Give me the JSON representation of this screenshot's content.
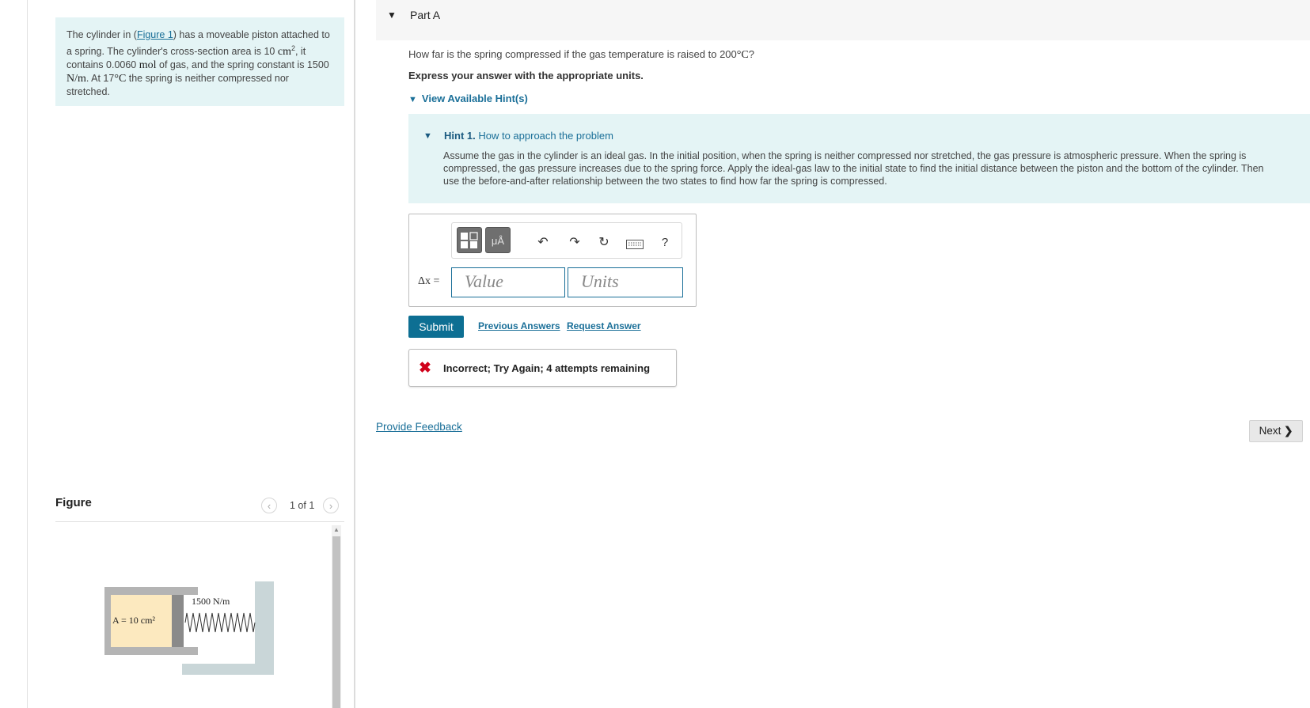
{
  "problem": {
    "text_1": "The cylinder in (",
    "figure_link": "Figure 1",
    "text_2": ") has a moveable piston attached to a spring. The cylinder's cross-section area is 10 ",
    "area_unit": "cm",
    "area_exp": "2",
    "text_3": ", it contains 0.0060 ",
    "mol_unit": "mol",
    "text_4": " of gas, and the spring constant is 1500 ",
    "k_unit": "N/m",
    "text_5": ". At 17",
    "temp_unit": "°C",
    "text_6": " the spring is neither compressed nor stretched."
  },
  "figure": {
    "title": "Figure",
    "pagination": "1 of 1",
    "prev_icon": "chevron-left-icon",
    "next_icon": "chevron-right-icon",
    "area_label": "A = 10 cm²",
    "spring_label": "1500 N/m"
  },
  "part": {
    "label": "Part A",
    "question_1": "How far is the spring compressed if the gas temperature is raised to 200",
    "question_unit": "°C",
    "question_2": "?",
    "instruction": "Express your answer with the appropriate units.",
    "hints_toggle": "View Available Hint(s)"
  },
  "hint": {
    "number": "Hint 1.",
    "title": "How to approach the problem",
    "body": "Assume the gas in the cylinder is an ideal gas. In the initial position, when the spring is neither compressed nor stretched, the gas pressure is atmospheric pressure. When the spring is compressed, the gas pressure increases due to the spring force. Apply the ideal-gas law to the initial state to find the initial distance between the piston and the bottom of the cylinder. Then use the before-and-after relationship between the two states to find how far the spring is compressed."
  },
  "answer": {
    "variable_label": "Δx =",
    "value_placeholder": "Value",
    "units_placeholder": "Units",
    "toolbar": {
      "units_button": "μÅ",
      "help": "?"
    }
  },
  "actions": {
    "submit": "Submit",
    "previous_answers": "Previous Answers",
    "request_answer": "Request Answer"
  },
  "feedback": {
    "result": "Incorrect; Try Again; 4 attempts remaining",
    "provide_feedback": "Provide Feedback",
    "next": "Next"
  },
  "colors": {
    "accent": "#0d6f93",
    "link": "#1a6f98",
    "hint_bg": "#e4f4f5",
    "error": "#d0021b"
  }
}
